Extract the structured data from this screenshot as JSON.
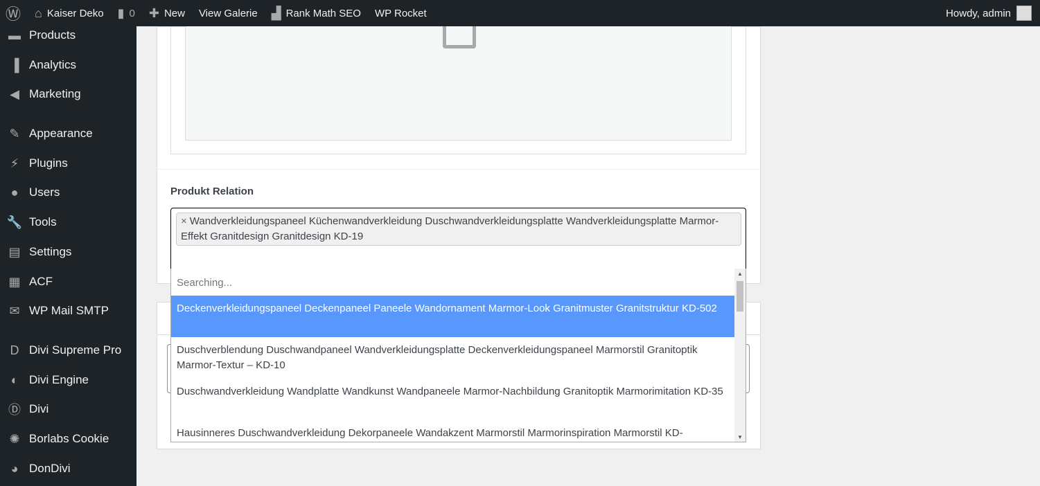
{
  "adminbar": {
    "site": "Kaiser Deko",
    "comments": "0",
    "new": "New",
    "view": "View Galerie",
    "rankmath": "Rank Math SEO",
    "rocket": "WP Rocket",
    "howdy": "Howdy, admin"
  },
  "sidebar": {
    "items": [
      {
        "label": "Products",
        "icon": "archive-icon"
      },
      {
        "label": "Analytics",
        "icon": "chart-bar-icon"
      },
      {
        "label": "Marketing",
        "icon": "megaphone-icon"
      },
      {
        "label": "Appearance",
        "icon": "paintbrush-icon"
      },
      {
        "label": "Plugins",
        "icon": "plug-icon"
      },
      {
        "label": "Users",
        "icon": "user-icon"
      },
      {
        "label": "Tools",
        "icon": "wrench-icon"
      },
      {
        "label": "Settings",
        "icon": "sliders-icon"
      },
      {
        "label": "ACF",
        "icon": "table-icon"
      },
      {
        "label": "WP Mail SMTP",
        "icon": "mail-icon"
      },
      {
        "label": "Divi Supreme Pro",
        "icon": "d-logo-icon"
      },
      {
        "label": "Divi Engine",
        "icon": "divi-engine-icon"
      },
      {
        "label": "Divi",
        "icon": "divi-icon"
      },
      {
        "label": "Borlabs Cookie",
        "icon": "cookie-icon"
      },
      {
        "label": "DonDivi",
        "icon": "dondivi-icon"
      }
    ]
  },
  "field": {
    "label": "Produkt Relation",
    "selected": "Wandverkleidungspaneel Küchenwandverkleidung Duschwandverkleidungsplatte Wandverkleidungsplatte Marmor-Effekt Granitdesign Granitdesign KD-19",
    "remove": "×"
  },
  "dropdown": {
    "search_placeholder": "Searching...",
    "highlight_color": "#5897fb",
    "options": [
      "Deckenverkleidungspaneel Deckenpaneel Paneele Wandornament Marmor-Look Granitmuster Granitstruktur KD-502",
      "Duschverblendung Duschwandpaneel Wandverkleidungsplatte Deckenverkleidungspaneel Marmorstil Granitoptik Marmor-Textur – KD-10",
      "Duschwandverkleidung Wandplatte Wandkunst Wandpaneele Marmor-Nachbildung Granitoptik Marmorimitation KD-35",
      "Hausinneres Duschwandverkleidung Dekorpaneele Wandakzent Marmorstil Marmorinspiration Marmorstil KD-"
    ]
  }
}
